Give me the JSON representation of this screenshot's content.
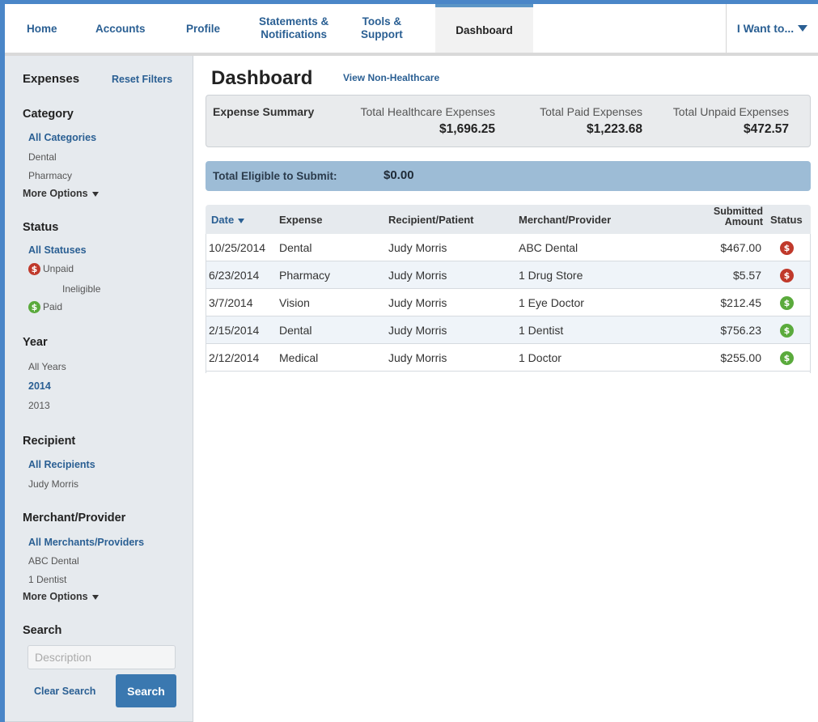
{
  "nav": {
    "home": "Home",
    "accounts": "Accounts",
    "profile": "Profile",
    "statements_line1": "Statements &",
    "statements_line2": "Notifications",
    "tools_line1": "Tools &",
    "tools_line2": "Support",
    "dashboard": "Dashboard",
    "i_want_to": "I Want to..."
  },
  "sidebar": {
    "title": "Expenses",
    "reset": "Reset Filters",
    "category": {
      "heading": "Category",
      "selected": "All Categories",
      "options": [
        "Dental",
        "Pharmacy"
      ],
      "more": "More Options"
    },
    "status": {
      "heading": "Status",
      "selected": "All Statuses",
      "unpaid": "Unpaid",
      "ineligible": "Ineligible",
      "paid": "Paid"
    },
    "year": {
      "heading": "Year",
      "all": "All Years",
      "selected": "2014",
      "other": "2013"
    },
    "recipient": {
      "heading": "Recipient",
      "selected": "All Recipients",
      "option": "Judy Morris"
    },
    "merchant": {
      "heading": "Merchant/Provider",
      "selected": "All Merchants/Providers",
      "options": [
        "ABC Dental",
        "1 Dentist"
      ],
      "more": "More Options"
    },
    "search": {
      "heading": "Search",
      "placeholder": "Description",
      "clear": "Clear Search",
      "button": "Search"
    }
  },
  "main": {
    "title": "Dashboard",
    "view_link": "View Non-Healthcare",
    "summary": {
      "label": "Expense Summary",
      "healthcare_label": "Total Healthcare Expenses",
      "healthcare_value": "$1,696.25",
      "paid_label": "Total Paid Expenses",
      "paid_value": "$1,223.68",
      "unpaid_label": "Total Unpaid Expenses",
      "unpaid_value": "$472.57"
    },
    "eligible": {
      "label": "Total Eligible to Submit:",
      "value": "$0.00"
    },
    "table": {
      "headers": {
        "date": "Date",
        "expense": "Expense",
        "recipient": "Recipient/Patient",
        "merchant": "Merchant/Provider",
        "amount_line1": "Submitted",
        "amount_line2": "Amount",
        "status": "Status"
      },
      "rows": [
        {
          "date": "10/25/2014",
          "expense": "Dental",
          "recipient": "Judy Morris",
          "merchant": "ABC Dental",
          "amount": "$467.00",
          "status": "unpaid"
        },
        {
          "date": "6/23/2014",
          "expense": "Pharmacy",
          "recipient": "Judy Morris",
          "merchant": "1 Drug Store",
          "amount": "$5.57",
          "status": "unpaid"
        },
        {
          "date": "3/7/2014",
          "expense": "Vision",
          "recipient": "Judy Morris",
          "merchant": "1 Eye Doctor",
          "amount": "$212.45",
          "status": "paid"
        },
        {
          "date": "2/15/2014",
          "expense": "Dental",
          "recipient": "Judy Morris",
          "merchant": "1 Dentist",
          "amount": "$756.23",
          "status": "paid"
        },
        {
          "date": "2/12/2014",
          "expense": "Medical",
          "recipient": "Judy Morris",
          "merchant": "1 Doctor",
          "amount": "$255.00",
          "status": "paid"
        }
      ]
    }
  },
  "colors": {
    "link": "#2a5f93",
    "unpaid": "#c0392b",
    "paid": "#5aaa3c",
    "eligible_bar": "#9dbcd6",
    "search_button": "#3a78b0"
  },
  "icons": {
    "status_unpaid": "dollar-red-icon",
    "status_paid": "dollar-green-icon",
    "dropdown": "chevron-down-icon"
  }
}
